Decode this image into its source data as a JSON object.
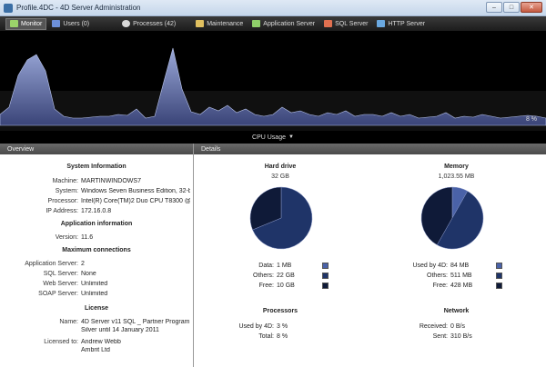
{
  "window": {
    "title": "Profile.4DC - 4D Server Administration"
  },
  "toolbar": {
    "items": [
      {
        "label": "Monitor",
        "icon": "monitor-icon",
        "color": "#9bd36a"
      },
      {
        "label": "Users (0)",
        "icon": "users-icon",
        "color": "#6c8fd8"
      },
      {
        "label": "Processes (42)",
        "icon": "processes-icon",
        "color": "#d8d8d8"
      },
      {
        "label": "Maintenance",
        "icon": "maintenance-icon",
        "color": "#e0c060"
      },
      {
        "label": "Application Server",
        "icon": "application-server-icon",
        "color": "#8fcf6a"
      },
      {
        "label": "SQL Server",
        "icon": "sql-server-icon",
        "color": "#e07050"
      },
      {
        "label": "HTTP Server",
        "icon": "http-server-icon",
        "color": "#6aa8e0"
      }
    ]
  },
  "graph": {
    "label": "CPU Usage",
    "current": "8 %",
    "samples": [
      12,
      20,
      55,
      72,
      78,
      60,
      18,
      10,
      8,
      8,
      9,
      10,
      10,
      12,
      11,
      18,
      8,
      10,
      48,
      85,
      40,
      15,
      12,
      20,
      16,
      22,
      14,
      18,
      12,
      10,
      12,
      20,
      14,
      16,
      12,
      10,
      14,
      12,
      16,
      10,
      12,
      12,
      10,
      14,
      10,
      12,
      8,
      9,
      10,
      14,
      8,
      10,
      9,
      12,
      10,
      8,
      9,
      10,
      11,
      10,
      8
    ]
  },
  "sections": {
    "overview": "Overview",
    "details": "Details"
  },
  "overview": {
    "system_heading": "System Information",
    "system": [
      {
        "label": "Machine:",
        "value": "MARTINWINDOWS7"
      },
      {
        "label": "System:",
        "value": "Windows Seven Business Edition, 32-b"
      },
      {
        "label": "Processor:",
        "value": "Intel(R) Core(TM)2 Duo CPU T8300 @ 2."
      },
      {
        "label": "IP Address:",
        "value": "172.16.0.8"
      }
    ],
    "app_heading": "Application information",
    "app": [
      {
        "label": "Version:",
        "value": "11.6"
      }
    ],
    "max_heading": "Maximum connections",
    "max": [
      {
        "label": "Application Server:",
        "value": "2"
      },
      {
        "label": "SQL Server:",
        "value": "None"
      },
      {
        "label": "Web Server:",
        "value": "Unlimited"
      },
      {
        "label": "SOAP Server:",
        "value": "Unlimited"
      }
    ],
    "license_heading": "License",
    "license_name_label": "Name:",
    "license_name_1": "4D Server v11 SQL _ Partner Program",
    "license_name_2": "Silver until 14 January 2011",
    "licensed_to_label": "Licensed to:",
    "licensed_to_1": "Andrew Webb",
    "licensed_to_2": "Ambrit Ltd"
  },
  "details": {
    "hard_drive": {
      "heading": "Hard drive",
      "total": "32 GB",
      "rows": [
        {
          "label": "Data:",
          "value": "1 MB",
          "color": "#4a62a8"
        },
        {
          "label": "Others:",
          "value": "22 GB",
          "color": "#1f3468"
        },
        {
          "label": "Free:",
          "value": "10 GB",
          "color": "#0f1a38"
        }
      ],
      "fractions": [
        0.0001,
        0.6875,
        0.3125
      ]
    },
    "memory": {
      "heading": "Memory",
      "total": "1,023.55 MB",
      "rows": [
        {
          "label": "Used by 4D:",
          "value": "84 MB",
          "color": "#4a62a8"
        },
        {
          "label": "Others:",
          "value": "511 MB",
          "color": "#1f3468"
        },
        {
          "label": "Free:",
          "value": "428 MB",
          "color": "#0f1a38"
        }
      ],
      "fractions": [
        0.082,
        0.5,
        0.418
      ]
    },
    "processors": {
      "heading": "Processors",
      "rows": [
        {
          "label": "Used by 4D:",
          "value": "3 %"
        },
        {
          "label": "Total:",
          "value": "8 %"
        }
      ]
    },
    "network": {
      "heading": "Network",
      "rows": [
        {
          "label": "Received:",
          "value": "0 B/s"
        },
        {
          "label": "Sent:",
          "value": "310 B/s"
        }
      ]
    }
  }
}
